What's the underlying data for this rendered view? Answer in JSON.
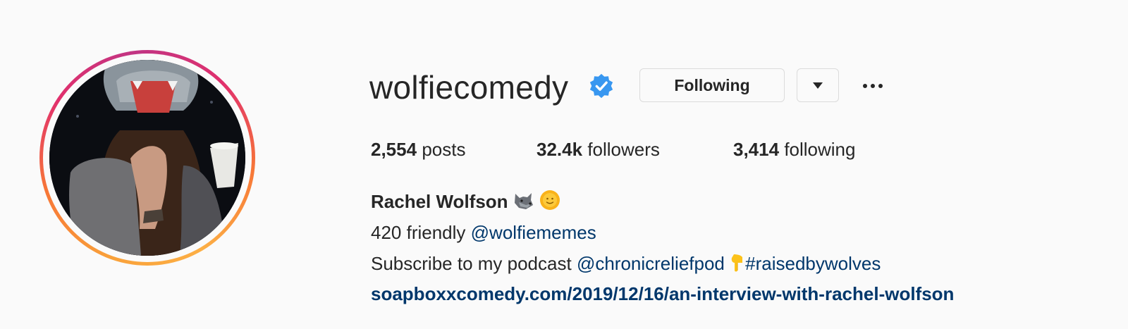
{
  "profile": {
    "username": "wolfiecomedy",
    "verified": true,
    "following_label": "Following",
    "dropdown_icon": "caret-down-icon",
    "more_icon": "ellipsis-icon"
  },
  "stats": {
    "posts_count": "2,554",
    "posts_label": "posts",
    "followers_count": "32.4k",
    "followers_label": "followers",
    "following_count": "3,414",
    "following_label": "following"
  },
  "bio": {
    "name": "Rachel Wolfson",
    "name_emojis": [
      "wolf",
      "sun-with-face"
    ],
    "line1_text": "420 friendly",
    "line1_mention": "@wolfiememes",
    "line2_text": "Subscribe to my podcast",
    "line2_mention": "@chronicreliefpod",
    "line2_emoji": "pointing-down",
    "line2_hashtag": "#raisedbywolves",
    "link": "soapboxxcomedy.com/2019/12/16/an-interview-with-rachel-wolfson"
  },
  "colors": {
    "link": "#00376b",
    "verified": "#3897f0",
    "ring_start": "#fcaf45",
    "ring_end": "#e1306c"
  }
}
